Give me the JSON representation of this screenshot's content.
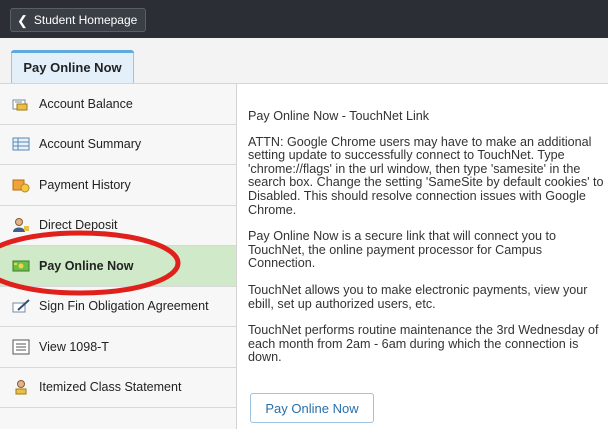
{
  "header": {
    "back_label": "Student Homepage"
  },
  "tabs": [
    {
      "label": "Pay Online Now"
    }
  ],
  "sidebar": {
    "items": [
      {
        "label": "Account Balance",
        "icon": "coin-stack-icon"
      },
      {
        "label": "Account Summary",
        "icon": "table-icon"
      },
      {
        "label": "Payment History",
        "icon": "folder-coins-icon"
      },
      {
        "label": "Direct Deposit",
        "icon": "person-icon"
      },
      {
        "label": "Pay Online Now",
        "icon": "money-card-icon",
        "active": true
      },
      {
        "label": "Sign Fin Obligation Agreement",
        "icon": "pen-sign-icon"
      },
      {
        "label": "View 1098-T",
        "icon": "list-icon"
      },
      {
        "label": "Itemized Class Statement",
        "icon": "person-statement-icon"
      }
    ]
  },
  "content": {
    "title": "Pay Online Now - TouchNet Link",
    "attn": "ATTN: Google Chrome users may have to make an additional setting update to successfully connect to TouchNet. Type 'chrome://flags' in the url window, then type 'samesite' in the search box. Change the setting 'SameSite by default cookies' to Disabled. This should resolve connection issues with Google Chrome.",
    "p1": "Pay Online Now is a secure link that will connect you to TouchNet, the online payment processor for Campus Connection.",
    "p2": "TouchNet allows you to make electronic payments, view your ebill, set up authorized users, etc.",
    "p3": "TouchNet performs routine maintenance the 3rd Wednesday of each month from 2am - 6am during which the connection is down.",
    "button_label": "Pay Online Now"
  },
  "colors": {
    "highlight_ellipse": "#e0201b",
    "active_item": "#cfe9c9",
    "accent": "#5fa9dd"
  }
}
